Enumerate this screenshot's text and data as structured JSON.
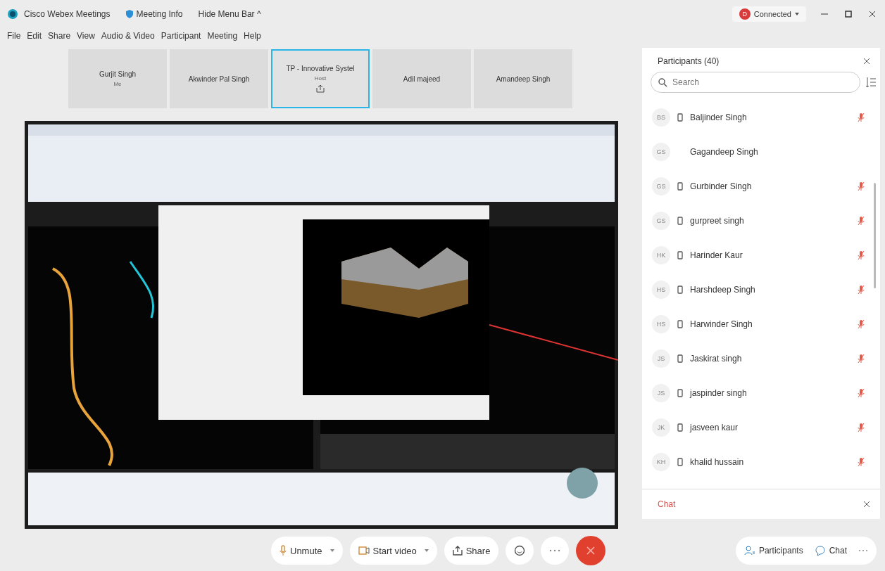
{
  "window": {
    "title": "Cisco Webex Meetings",
    "meeting_info": "Meeting Info",
    "hide_menu": "Hide Menu Bar ^",
    "status": "Connected",
    "status_initial": "D"
  },
  "menu": [
    "File",
    "Edit",
    "Share",
    "View",
    "Audio & Video",
    "Participant",
    "Meeting",
    "Help"
  ],
  "tiles": [
    {
      "name": "Gurjit Singh",
      "role": "Me",
      "selected": false,
      "sharing": false
    },
    {
      "name": "Akwinder Pal Singh",
      "selected": false,
      "sharing": false
    },
    {
      "name": "TP - Innovative Systel",
      "role": "Host",
      "selected": true,
      "sharing": true
    },
    {
      "name": "Adil majeed",
      "selected": false,
      "sharing": false
    },
    {
      "name": "Amandeep Singh",
      "selected": false,
      "sharing": false
    }
  ],
  "participants": {
    "title": "Participants (40)",
    "search": {
      "placeholder": "Search"
    },
    "items": [
      {
        "initials": "BS",
        "name": "Baljinder Singh",
        "phone": true,
        "muted": true
      },
      {
        "initials": "GS",
        "name": "Gagandeep Singh",
        "phone": false,
        "muted": false
      },
      {
        "initials": "GS",
        "name": "Gurbinder Singh",
        "phone": true,
        "muted": true
      },
      {
        "initials": "GS",
        "name": "gurpreet singh",
        "phone": true,
        "muted": true
      },
      {
        "initials": "HK",
        "name": "Harinder Kaur",
        "phone": true,
        "muted": true
      },
      {
        "initials": "HS",
        "name": "Harshdeep Singh",
        "phone": true,
        "muted": true
      },
      {
        "initials": "HS",
        "name": "Harwinder Singh",
        "phone": true,
        "muted": true
      },
      {
        "initials": "JS",
        "name": "Jaskirat singh",
        "phone": true,
        "muted": true
      },
      {
        "initials": "JS",
        "name": "jaspinder singh",
        "phone": true,
        "muted": true
      },
      {
        "initials": "JK",
        "name": "jasveen kaur",
        "phone": true,
        "muted": true
      },
      {
        "initials": "KH",
        "name": "khalid hussain",
        "phone": true,
        "muted": true
      }
    ]
  },
  "chat": {
    "title": "Chat"
  },
  "controls": [
    {
      "kind": "mic",
      "label": "Unmute"
    },
    {
      "kind": "video",
      "label": "Start video"
    },
    {
      "kind": "share",
      "label": "Share"
    }
  ],
  "panel_buttons": [
    {
      "kind": "participants",
      "label": "Participants"
    },
    {
      "kind": "chat",
      "label": "Chat"
    }
  ]
}
